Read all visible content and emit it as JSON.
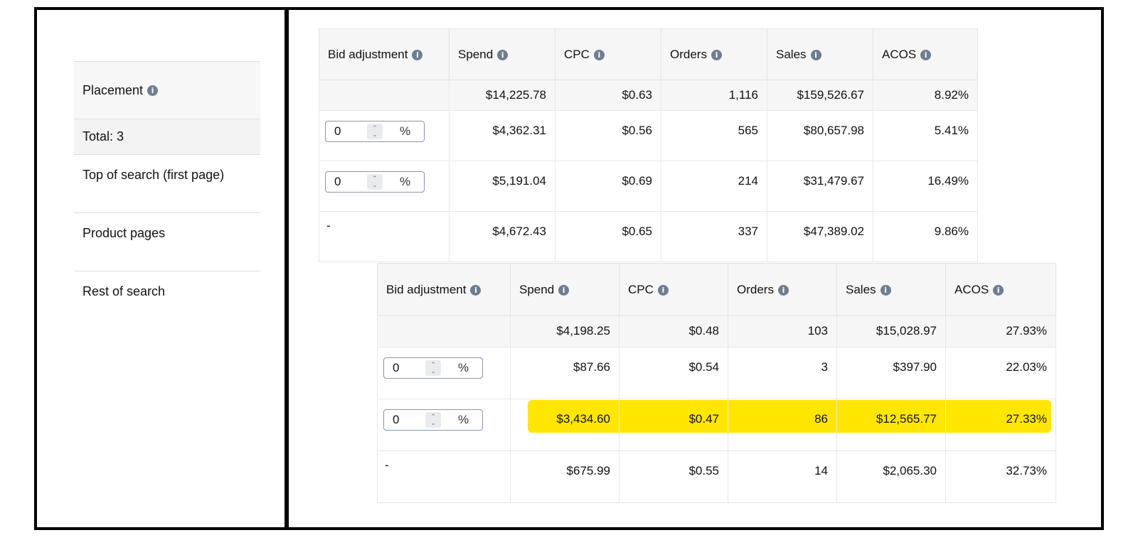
{
  "left": {
    "header": "Placement",
    "total": "Total: 3",
    "rows": [
      "Top of search (first page)",
      "Product pages",
      "Rest of search"
    ]
  },
  "columns": [
    "Bid adjustment",
    "Spend",
    "CPC",
    "Orders",
    "Sales",
    "ACOS"
  ],
  "pct_symbol": "%",
  "table1": {
    "totals": [
      "$14,225.78",
      "$0.63",
      "1,116",
      "$159,526.67",
      "8.92%"
    ],
    "rows": [
      {
        "bid": "0",
        "values": [
          "$4,362.31",
          "$0.56",
          "565",
          "$80,657.98",
          "5.41%"
        ]
      },
      {
        "bid": "0",
        "values": [
          "$5,191.04",
          "$0.69",
          "214",
          "$31,479.67",
          "16.49%"
        ]
      },
      {
        "bid": "-",
        "values": [
          "$4,672.43",
          "$0.65",
          "337",
          "$47,389.02",
          "9.86%"
        ]
      }
    ]
  },
  "table2": {
    "totals": [
      "$4,198.25",
      "$0.48",
      "103",
      "$15,028.97",
      "27.93%"
    ],
    "rows": [
      {
        "bid": "0",
        "values": [
          "$87.66",
          "$0.54",
          "3",
          "$397.90",
          "22.03%"
        ]
      },
      {
        "bid": "0",
        "values": [
          "$3,434.60",
          "$0.47",
          "86",
          "$12,565.77",
          "27.33%"
        ],
        "highlighted": true
      },
      {
        "bid": "-",
        "values": [
          "$675.99",
          "$0.55",
          "14",
          "$2,065.30",
          "32.73%"
        ]
      }
    ]
  },
  "colors": {
    "highlight": "#ffe600",
    "info_icon": "#6f7d91",
    "header_bg": "#f6f6f6"
  }
}
